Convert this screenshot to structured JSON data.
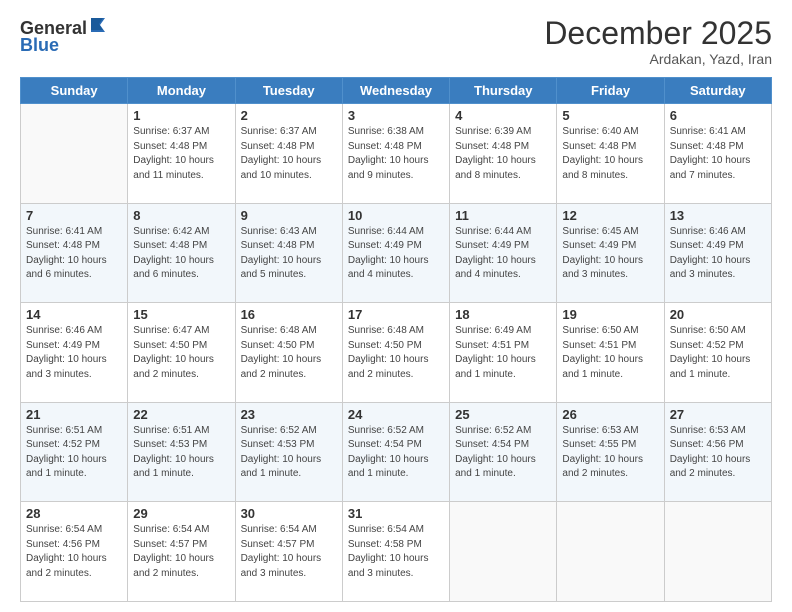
{
  "header": {
    "logo_line1": "General",
    "logo_line2": "Blue",
    "month": "December 2025",
    "location": "Ardakan, Yazd, Iran"
  },
  "days_of_week": [
    "Sunday",
    "Monday",
    "Tuesday",
    "Wednesday",
    "Thursday",
    "Friday",
    "Saturday"
  ],
  "weeks": [
    [
      {
        "day": "",
        "info": ""
      },
      {
        "day": "1",
        "info": "Sunrise: 6:37 AM\nSunset: 4:48 PM\nDaylight: 10 hours\nand 11 minutes."
      },
      {
        "day": "2",
        "info": "Sunrise: 6:37 AM\nSunset: 4:48 PM\nDaylight: 10 hours\nand 10 minutes."
      },
      {
        "day": "3",
        "info": "Sunrise: 6:38 AM\nSunset: 4:48 PM\nDaylight: 10 hours\nand 9 minutes."
      },
      {
        "day": "4",
        "info": "Sunrise: 6:39 AM\nSunset: 4:48 PM\nDaylight: 10 hours\nand 8 minutes."
      },
      {
        "day": "5",
        "info": "Sunrise: 6:40 AM\nSunset: 4:48 PM\nDaylight: 10 hours\nand 8 minutes."
      },
      {
        "day": "6",
        "info": "Sunrise: 6:41 AM\nSunset: 4:48 PM\nDaylight: 10 hours\nand 7 minutes."
      }
    ],
    [
      {
        "day": "7",
        "info": "Sunrise: 6:41 AM\nSunset: 4:48 PM\nDaylight: 10 hours\nand 6 minutes."
      },
      {
        "day": "8",
        "info": "Sunrise: 6:42 AM\nSunset: 4:48 PM\nDaylight: 10 hours\nand 6 minutes."
      },
      {
        "day": "9",
        "info": "Sunrise: 6:43 AM\nSunset: 4:48 PM\nDaylight: 10 hours\nand 5 minutes."
      },
      {
        "day": "10",
        "info": "Sunrise: 6:44 AM\nSunset: 4:49 PM\nDaylight: 10 hours\nand 4 minutes."
      },
      {
        "day": "11",
        "info": "Sunrise: 6:44 AM\nSunset: 4:49 PM\nDaylight: 10 hours\nand 4 minutes."
      },
      {
        "day": "12",
        "info": "Sunrise: 6:45 AM\nSunset: 4:49 PM\nDaylight: 10 hours\nand 3 minutes."
      },
      {
        "day": "13",
        "info": "Sunrise: 6:46 AM\nSunset: 4:49 PM\nDaylight: 10 hours\nand 3 minutes."
      }
    ],
    [
      {
        "day": "14",
        "info": "Sunrise: 6:46 AM\nSunset: 4:49 PM\nDaylight: 10 hours\nand 3 minutes."
      },
      {
        "day": "15",
        "info": "Sunrise: 6:47 AM\nSunset: 4:50 PM\nDaylight: 10 hours\nand 2 minutes."
      },
      {
        "day": "16",
        "info": "Sunrise: 6:48 AM\nSunset: 4:50 PM\nDaylight: 10 hours\nand 2 minutes."
      },
      {
        "day": "17",
        "info": "Sunrise: 6:48 AM\nSunset: 4:50 PM\nDaylight: 10 hours\nand 2 minutes."
      },
      {
        "day": "18",
        "info": "Sunrise: 6:49 AM\nSunset: 4:51 PM\nDaylight: 10 hours\nand 1 minute."
      },
      {
        "day": "19",
        "info": "Sunrise: 6:50 AM\nSunset: 4:51 PM\nDaylight: 10 hours\nand 1 minute."
      },
      {
        "day": "20",
        "info": "Sunrise: 6:50 AM\nSunset: 4:52 PM\nDaylight: 10 hours\nand 1 minute."
      }
    ],
    [
      {
        "day": "21",
        "info": "Sunrise: 6:51 AM\nSunset: 4:52 PM\nDaylight: 10 hours\nand 1 minute."
      },
      {
        "day": "22",
        "info": "Sunrise: 6:51 AM\nSunset: 4:53 PM\nDaylight: 10 hours\nand 1 minute."
      },
      {
        "day": "23",
        "info": "Sunrise: 6:52 AM\nSunset: 4:53 PM\nDaylight: 10 hours\nand 1 minute."
      },
      {
        "day": "24",
        "info": "Sunrise: 6:52 AM\nSunset: 4:54 PM\nDaylight: 10 hours\nand 1 minute."
      },
      {
        "day": "25",
        "info": "Sunrise: 6:52 AM\nSunset: 4:54 PM\nDaylight: 10 hours\nand 1 minute."
      },
      {
        "day": "26",
        "info": "Sunrise: 6:53 AM\nSunset: 4:55 PM\nDaylight: 10 hours\nand 2 minutes."
      },
      {
        "day": "27",
        "info": "Sunrise: 6:53 AM\nSunset: 4:56 PM\nDaylight: 10 hours\nand 2 minutes."
      }
    ],
    [
      {
        "day": "28",
        "info": "Sunrise: 6:54 AM\nSunset: 4:56 PM\nDaylight: 10 hours\nand 2 minutes."
      },
      {
        "day": "29",
        "info": "Sunrise: 6:54 AM\nSunset: 4:57 PM\nDaylight: 10 hours\nand 2 minutes."
      },
      {
        "day": "30",
        "info": "Sunrise: 6:54 AM\nSunset: 4:57 PM\nDaylight: 10 hours\nand 3 minutes."
      },
      {
        "day": "31",
        "info": "Sunrise: 6:54 AM\nSunset: 4:58 PM\nDaylight: 10 hours\nand 3 minutes."
      },
      {
        "day": "",
        "info": ""
      },
      {
        "day": "",
        "info": ""
      },
      {
        "day": "",
        "info": ""
      }
    ]
  ]
}
